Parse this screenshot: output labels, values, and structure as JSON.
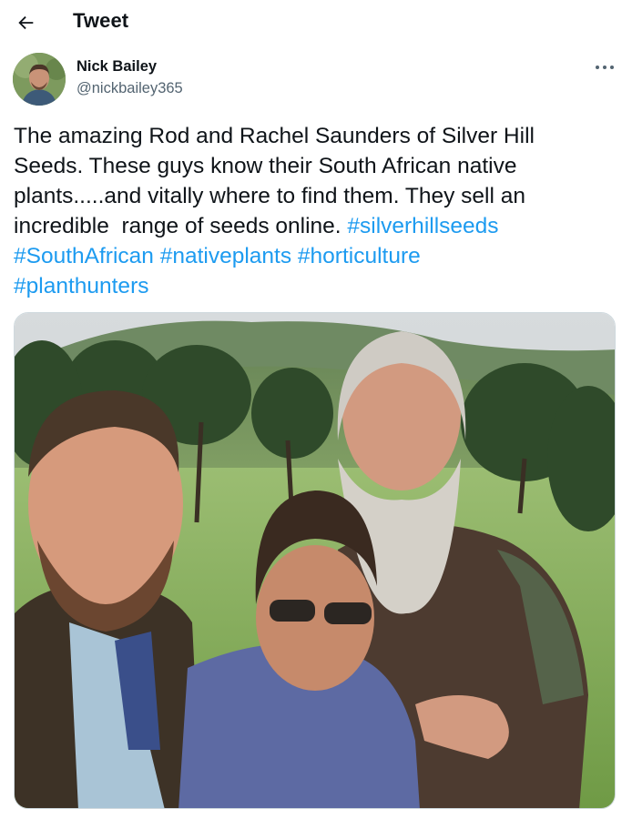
{
  "header": {
    "title": "Tweet",
    "back_icon": "arrow-left-icon"
  },
  "author": {
    "name": "Nick Bailey",
    "handle": "@nickbailey365"
  },
  "more_icon": "more-horizontal-icon",
  "tweet": {
    "lines": [
      [
        {
          "text": "The amazing Rod and Rachel Saunders of Silver Hill"
        }
      ],
      [
        {
          "text": "Seeds. These guys know their South African native"
        }
      ],
      [
        {
          "text": "plants.....and vitally where to find them. They sell an"
        }
      ],
      [
        {
          "text": "incredible  range of seeds online. "
        },
        {
          "text": "#silverhillseeds",
          "hashtag": true
        }
      ],
      [
        {
          "text": "#SouthAfrican",
          "hashtag": true
        },
        {
          "text": " "
        },
        {
          "text": "#nativeplants",
          "hashtag": true
        },
        {
          "text": " "
        },
        {
          "text": "#horticulture",
          "hashtag": true
        }
      ],
      [
        {
          "text": "#planthunters",
          "hashtag": true
        }
      ]
    ]
  },
  "colors": {
    "link": "#1d9bf0",
    "secondary_text": "#536471",
    "text": "#0f1419"
  }
}
